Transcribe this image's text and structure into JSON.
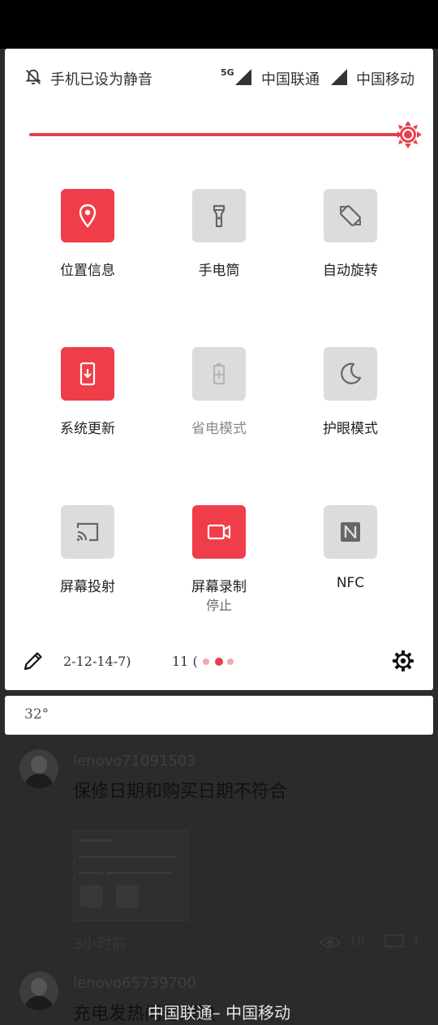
{
  "status": {
    "silent_text": "手机已设为静音",
    "network_tag": "5G",
    "carrier_1": "中国联通",
    "carrier_2": "中国移动"
  },
  "brightness": {
    "level": 1.0,
    "accent_color": "#e5404b"
  },
  "tiles": [
    {
      "label": "位置信息",
      "icon": "location-pin-icon",
      "active": true
    },
    {
      "label": "手电筒",
      "icon": "flashlight-icon",
      "active": false
    },
    {
      "label": "自动旋转",
      "icon": "auto-rotate-icon",
      "active": false
    },
    {
      "label": "系统更新",
      "icon": "system-update-icon",
      "active": true
    },
    {
      "label": "省电模式",
      "icon": "battery-saver-icon",
      "active": false,
      "disabled": true
    },
    {
      "label": "护眼模式",
      "icon": "moon-icon",
      "active": false
    },
    {
      "label": "屏幕投射",
      "icon": "cast-icon",
      "active": false
    },
    {
      "label": "屏幕录制",
      "sublabel": "停止",
      "icon": "screen-record-icon",
      "active": true
    },
    {
      "label": "NFC",
      "icon": "nfc-icon",
      "active": false
    }
  ],
  "footer": {
    "build_text": "2-12-14-7)",
    "page_text": "11 (",
    "page_count": 3,
    "current_page": 2
  },
  "temperature": "32°",
  "background": {
    "posts": [
      {
        "user": "lenovo71091503",
        "text": "保修日期和购买日期不符合",
        "time": "3小时前",
        "views": "18",
        "comments": "1"
      },
      {
        "user": "lenovo65739700",
        "text": "充电发热问题解决"
      }
    ],
    "bottom_carrier": "中国联通–  中国移动"
  },
  "colors": {
    "accent": "#f03d4a",
    "tile_off": "#dcdcdc",
    "icon_gray": "#6e6e6e"
  }
}
